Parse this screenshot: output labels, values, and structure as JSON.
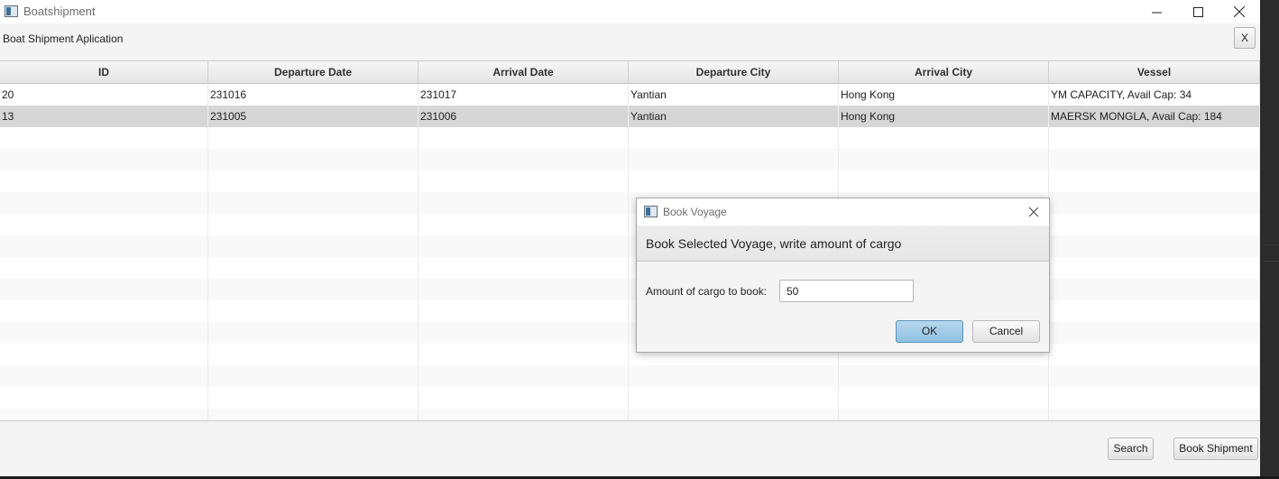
{
  "window": {
    "title": "Boatshipment",
    "icon": "app-window-icon"
  },
  "appbar": {
    "label": "Boat Shipment Aplication",
    "close_label": "X"
  },
  "table": {
    "columns": [
      "ID",
      "Departure Date",
      "Arrival Date",
      "Departure City",
      "Arrival City",
      "Vessel"
    ],
    "rows": [
      [
        "20",
        "231016",
        "231017",
        "Yantian",
        "Hong Kong",
        "YM CAPACITY, Avail Cap: 34"
      ],
      [
        "13",
        "231005",
        "231006",
        "Yantian",
        "Hong Kong",
        "MAERSK MONGLA, Avail Cap: 184"
      ]
    ],
    "selected_row": 1
  },
  "footer": {
    "search_label": "Search",
    "book_label": "Book Shipment"
  },
  "dialog": {
    "title": "Book Voyage",
    "header": "Book Selected Voyage, write amount of cargo",
    "field_label": "Amount of cargo to book:",
    "field_value": "50",
    "ok_label": "OK",
    "cancel_label": "Cancel"
  }
}
